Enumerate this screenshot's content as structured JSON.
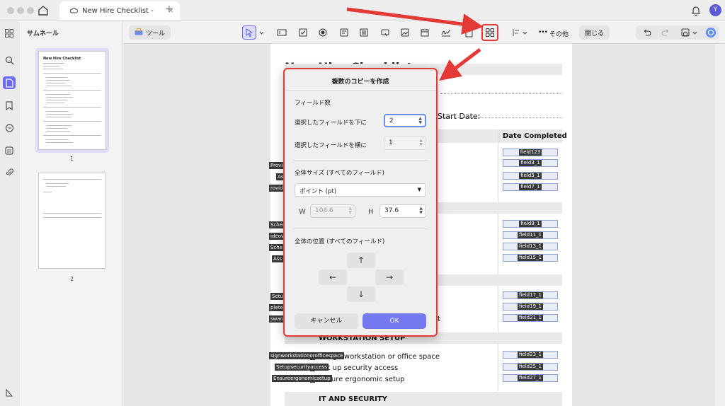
{
  "window": {
    "tab_title": "New Hire Checklist -",
    "tab_close": "×",
    "tab_add": "+",
    "avatar_letter": "Y"
  },
  "thumbnails": {
    "title": "サムネール",
    "page_label_1": "1",
    "page_label_2": "2",
    "thumb_heading": "New Hire Checklist"
  },
  "toolbar": {
    "tools_label": "ツール",
    "more_label": "その他",
    "close_label": "閉じる",
    "more_dots": "•••"
  },
  "document": {
    "title": "New Hire Checklist",
    "start_date": "Start Date:",
    "date_completed": "Date Completed",
    "section_workstation": "WORKSTATION SETUP",
    "section_it": "IT AND SECURITY",
    "row_workstation": "Assign workstation or office space",
    "row_security": "Set up security access",
    "row_ergonomic": "Ensure ergonomic setup",
    "row_partial": "t",
    "fields": [
      "field123",
      "field3_1",
      "field5_1",
      "field7_1",
      "field9_1",
      "field11_1",
      "field13_1",
      "field15_1",
      "field17_1",
      "field19_1",
      "field21_1",
      "field23_1",
      "field25_1",
      "field27_1"
    ],
    "side_tags": [
      "Provid",
      "As",
      "rovide",
      "Sched",
      "ideov",
      "Sche",
      "Ass",
      "Setu",
      "pleter",
      "swand",
      "signworkstationorofficespace",
      "Setupsecurityaccess",
      "Ensureergonomicsetup"
    ]
  },
  "dialog": {
    "title": "複数のコピーを作成",
    "field_count_head": "フィールド数",
    "down_label": "選択したフィールドを下に",
    "down_value": "2",
    "across_label": "選択したフィールドを横に",
    "across_value": "1",
    "size_head": "全体サイズ (すべてのフィールド)",
    "unit_value": "ポイント (pt)",
    "w_label": "W",
    "w_value": "104.6",
    "h_label": "H",
    "h_value": "37.6",
    "position_head": "全体の位置 (すべてのフィールド)",
    "arrow_up": "↑",
    "arrow_left": "←",
    "arrow_right": "→",
    "arrow_down": "↓",
    "cancel_label": "キャンセル",
    "ok_label": "OK"
  },
  "colors": {
    "accent": "#6b6bf0",
    "highlight_red": "#e53935",
    "ok_button": "#7479f2"
  }
}
